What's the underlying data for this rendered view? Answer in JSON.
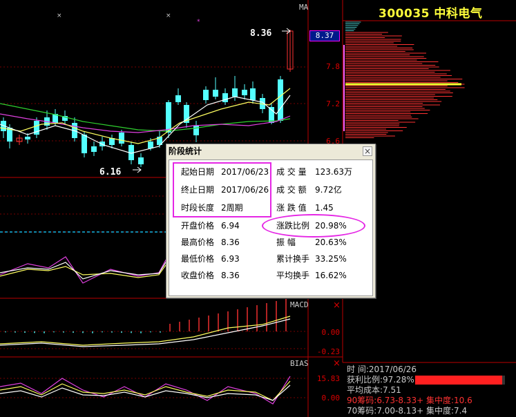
{
  "stock": {
    "code_name": "300035  中科电气"
  },
  "main_chart": {
    "indicator_label": "MA",
    "high_label": "8.36",
    "low_label": "6.16",
    "current_price": "8.37",
    "y_ticks": [
      "7.8",
      "7.2",
      "6.6"
    ]
  },
  "macd": {
    "label": "MACD",
    "y_ticks": [
      "0.00",
      "-0.23"
    ]
  },
  "bias": {
    "label": "BIAS",
    "y_ticks": [
      "15.83",
      "0.00"
    ]
  },
  "dialog": {
    "title": "阶段统计",
    "close": "×",
    "left_rows": [
      {
        "label": "起始日期",
        "value": "2017/06/23"
      },
      {
        "label": "终止日期",
        "value": "2017/06/26"
      },
      {
        "label": "时段长度",
        "value": "2周期"
      },
      {
        "label": "开盘价格",
        "value": "6.94"
      },
      {
        "label": "最高价格",
        "value": "8.36"
      },
      {
        "label": "最低价格",
        "value": "6.93"
      },
      {
        "label": "收盘价格",
        "value": "8.36"
      }
    ],
    "right_rows": [
      {
        "label": "成 交 量",
        "value": "123.63万"
      },
      {
        "label": "成 交 额",
        "value": "9.72亿"
      },
      {
        "label": "涨 跌 值",
        "value": "1.45"
      },
      {
        "label": "涨跌比例",
        "value": "20.98%"
      },
      {
        "label": "振     幅",
        "value": "20.63%"
      },
      {
        "label": "累计换手",
        "value": "33.25%"
      },
      {
        "label": "平均换手",
        "value": "16.62%"
      }
    ]
  },
  "chip_panel": {
    "time_label": "时       间:",
    "time_value": "2017/06/26",
    "profit_label": "获利比例:",
    "profit_value": "97.28%",
    "profit_ratio": 0.9728,
    "avg_cost": "平均成本:7.51",
    "chip90": "90筹码:6.73-8.33+ 集中度:10.6",
    "chip70": "70筹码:7.00-8.13+ 集中度:7.4"
  },
  "colors": {
    "up": "#ff3232",
    "down": "#54ffff",
    "highlight_ring": "#e526e5",
    "title_yellow": "#ffff3a"
  }
}
